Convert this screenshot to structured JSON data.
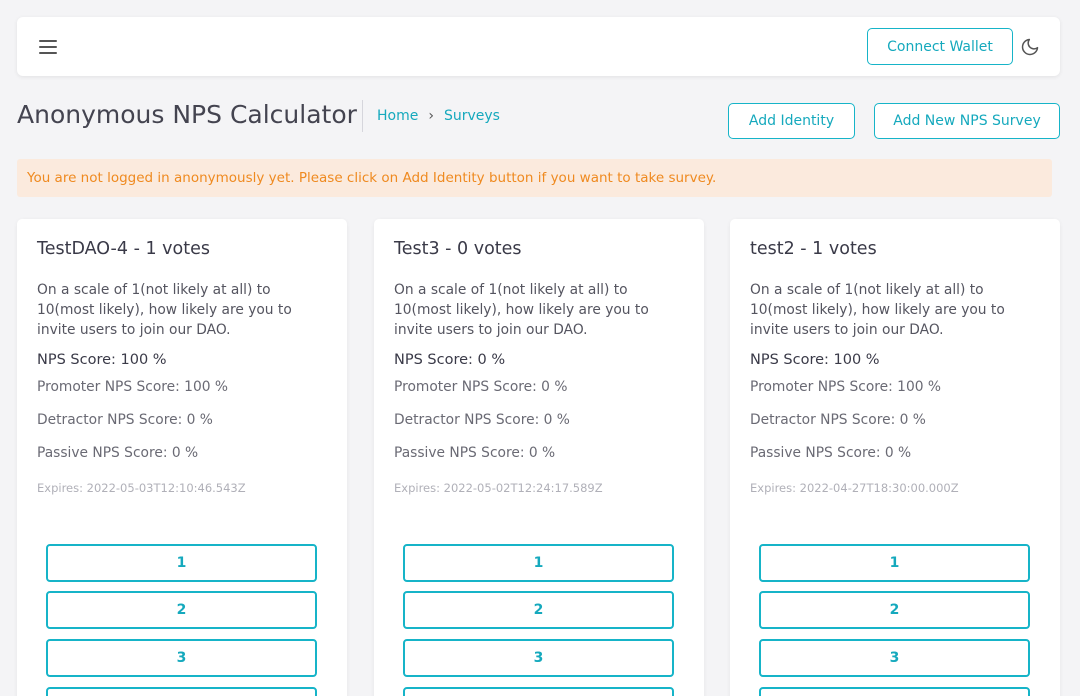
{
  "header": {
    "connect_wallet": "Connect Wallet"
  },
  "page": {
    "title": "Anonymous NPS Calculator",
    "breadcrumb": [
      "Home",
      "Surveys"
    ]
  },
  "actions": {
    "add_identity": "Add Identity",
    "add_survey": "Add New NPS Survey"
  },
  "alert": {
    "text": "You are not logged in anonymously yet. Please click on Add Identity button if you want to take survey."
  },
  "colors": {
    "accent": "#16b4c8",
    "alert_bg": "#fbeadd",
    "alert_text": "#ef8a20"
  },
  "surveys": [
    {
      "title": "TestDAO-4 - 1 votes",
      "question": "On a scale of 1(not likely at all) to 10(most likely), how likely are you to invite users to join our DAO.",
      "nps": "NPS Score: 100 %",
      "promoter": "Promoter NPS Score: 100 %",
      "detractor": "Detractor NPS Score: 0 %",
      "passive": "Passive NPS Score: 0 %",
      "expires": "Expires: 2022-05-03T12:10:46.543Z",
      "options": [
        "1",
        "2",
        "3"
      ]
    },
    {
      "title": "Test3 - 0 votes",
      "question": "On a scale of 1(not likely at all) to 10(most likely), how likely are you to invite users to join our DAO.",
      "nps": "NPS Score: 0 %",
      "promoter": "Promoter NPS Score: 0 %",
      "detractor": "Detractor NPS Score: 0 %",
      "passive": "Passive NPS Score: 0 %",
      "expires": "Expires: 2022-05-02T12:24:17.589Z",
      "options": [
        "1",
        "2",
        "3"
      ]
    },
    {
      "title": "test2 - 1 votes",
      "question": "On a scale of 1(not likely at all) to 10(most likely), how likely are you to invite users to join our DAO.",
      "nps": "NPS Score: 100 %",
      "promoter": "Promoter NPS Score: 100 %",
      "detractor": "Detractor NPS Score: 0 %",
      "passive": "Passive NPS Score: 0 %",
      "expires": "Expires: 2022-04-27T18:30:00.000Z",
      "options": [
        "1",
        "2",
        "3"
      ]
    }
  ]
}
